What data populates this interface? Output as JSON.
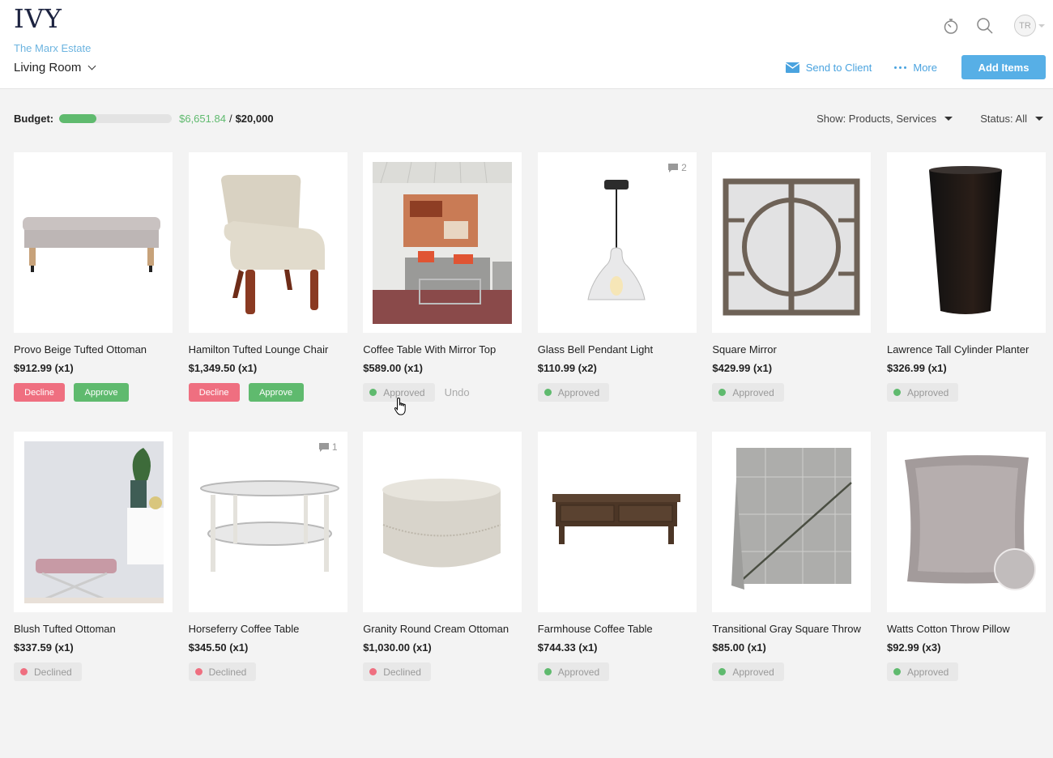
{
  "app": {
    "logo": "IVY"
  },
  "header": {
    "project": "The Marx Estate",
    "room": "Living Room",
    "user_initials": "TR",
    "actions": {
      "send_to_client": "Send to Client",
      "more": "More",
      "add_items": "Add Items"
    }
  },
  "budget": {
    "label": "Budget:",
    "spent": "$6,651.84",
    "separator": "/",
    "total": "$20,000",
    "fraction_spent": 0.3326
  },
  "filters": {
    "show": "Show: Products, Services",
    "status": "Status: All"
  },
  "colors": {
    "accent": "#57afe6",
    "approve": "#5fba6e",
    "decline": "#ef6f80"
  },
  "status_labels": {
    "approved": "Approved",
    "declined": "Declined",
    "decline_button": "Decline",
    "approve_button": "Approve",
    "undo": "Undo"
  },
  "items": [
    {
      "name": "Provo Beige Tufted Ottoman",
      "price": "$912.99 (x1)",
      "status": "pending",
      "comments": null,
      "image": "bench"
    },
    {
      "name": "Hamilton Tufted Lounge Chair",
      "price": "$1,349.50 (x1)",
      "status": "pending",
      "comments": null,
      "image": "chair"
    },
    {
      "name": "Coffee Table With Mirror Top",
      "price": "$589.00 (x1)",
      "status": "approved",
      "undo": true,
      "comments": null,
      "image": "room"
    },
    {
      "name": "Glass Bell Pendant Light",
      "price": "$110.99 (x2)",
      "status": "approved",
      "comments": "2",
      "image": "pendant"
    },
    {
      "name": "Square Mirror",
      "price": "$429.99 (x1)",
      "status": "approved",
      "comments": null,
      "image": "mirror"
    },
    {
      "name": "Lawrence Tall Cylinder Planter",
      "price": "$326.99 (x1)",
      "status": "approved",
      "comments": null,
      "image": "planter"
    },
    {
      "name": "Blush Tufted Ottoman",
      "price": "$337.59 (x1)",
      "status": "declined",
      "comments": null,
      "image": "blush"
    },
    {
      "name": "Horseferry Coffee Table",
      "price": "$345.50 (x1)",
      "status": "declined",
      "comments": "1",
      "image": "roundtable"
    },
    {
      "name": "Granity Round Cream Ottoman",
      "price": "$1,030.00 (x1)",
      "status": "declined",
      "comments": null,
      "image": "roundottoman"
    },
    {
      "name": "Farmhouse Coffee Table",
      "price": "$744.33 (x1)",
      "status": "approved",
      "comments": null,
      "image": "farmtable"
    },
    {
      "name": "Transitional Gray Square Throw",
      "price": "$85.00 (x1)",
      "status": "approved",
      "comments": null,
      "image": "throw"
    },
    {
      "name": "Watts Cotton Throw Pillow",
      "price": "$92.99 (x3)",
      "status": "approved",
      "comments": null,
      "image": "pillow"
    }
  ]
}
